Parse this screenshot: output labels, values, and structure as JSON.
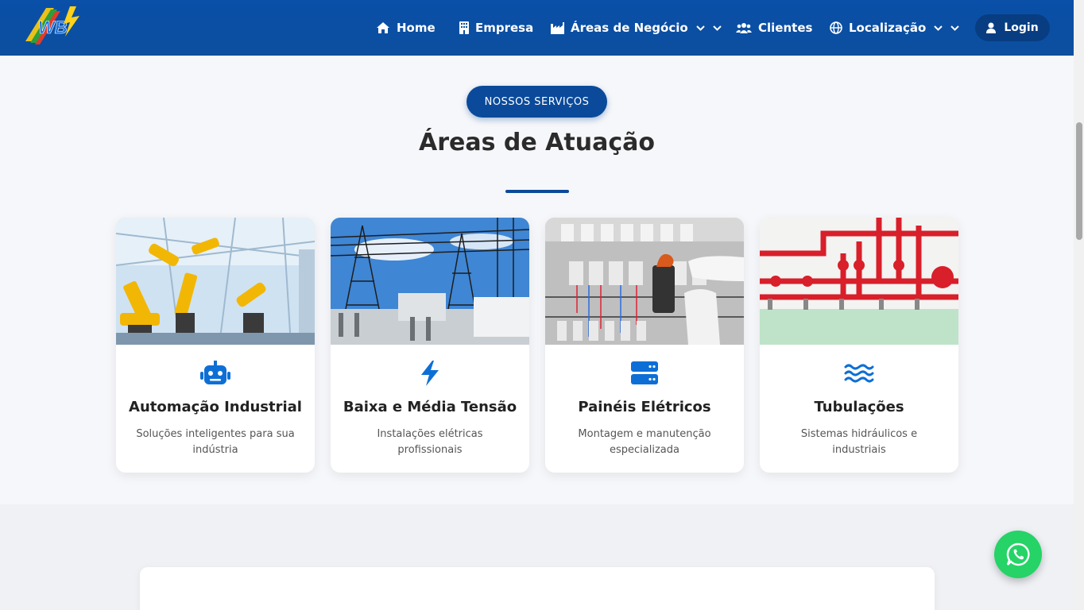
{
  "brand": {
    "logo_text": "WB"
  },
  "nav": {
    "home": "Home",
    "empresa": "Empresa",
    "areas": "Áreas de Negócio",
    "clientes": "Clientes",
    "localizacao": "Localização",
    "login": "Login"
  },
  "section": {
    "badge": "NOSSOS SERVIÇOS",
    "title": "Áreas de Atuação"
  },
  "cards": [
    {
      "title": "Automação Industrial",
      "description": "Soluções inteligentes para sua indústria",
      "icon": "robot-icon"
    },
    {
      "title": "Baixa e Média Tensão",
      "description": "Instalações elétricas profissionais",
      "icon": "bolt-icon"
    },
    {
      "title": "Painéis Elétricos",
      "description": "Montagem e manutenção especializada",
      "icon": "server-icon"
    },
    {
      "title": "Tubulações",
      "description": "Sistemas hidráulicos e industriais",
      "icon": "water-icon"
    }
  ],
  "colors": {
    "primary": "#0b4a9a",
    "accent_icon": "#0d6fd6",
    "whatsapp": "#25d366"
  }
}
